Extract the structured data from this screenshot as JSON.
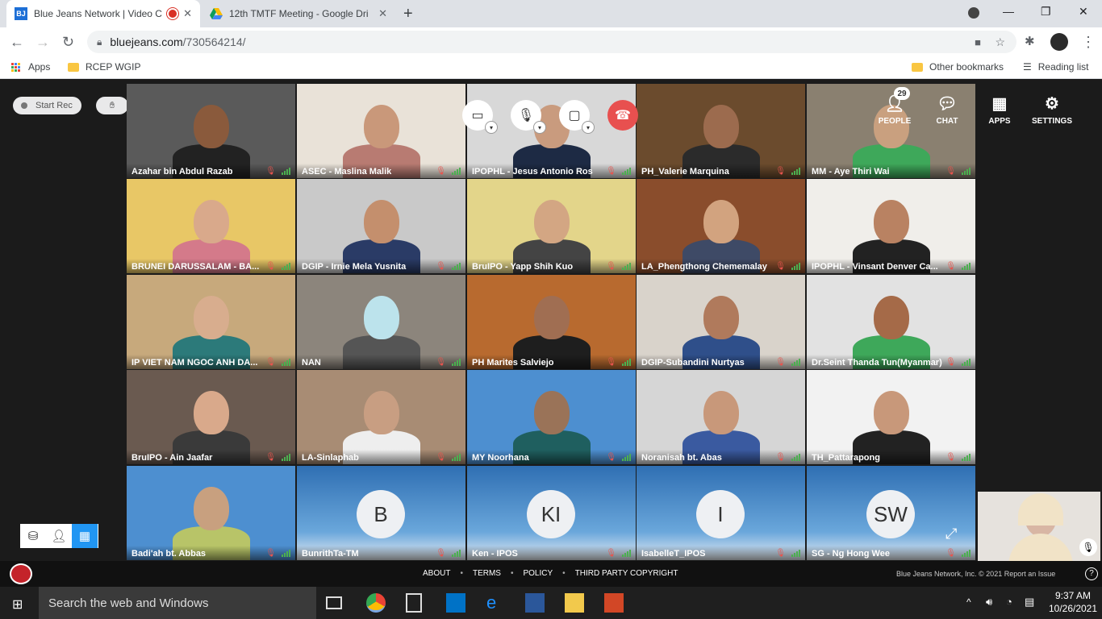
{
  "browser": {
    "tabs": [
      {
        "title": "Blue Jeans Network | Video C",
        "recording": true
      },
      {
        "title": "12th TMTF Meeting - Google Dri"
      }
    ],
    "url_domain": "bluejeans.com",
    "url_path": "/730564214/",
    "bookmarks": {
      "apps": "Apps",
      "folder": "RCEP WGIP",
      "other": "Other bookmarks",
      "reading": "Reading list"
    }
  },
  "meeting": {
    "start_rec": "Start Rec",
    "people_count": "29",
    "right_buttons": {
      "people": "PEOPLE",
      "chat": "CHAT",
      "apps": "APPS",
      "settings": "SETTINGS"
    },
    "participants": [
      {
        "name": "Azahar bin Abdul Razab",
        "bg": "#5a5a5a",
        "skin": "#8a5a3c",
        "cloth": "#222"
      },
      {
        "name": "ASEC - Maslina Malik",
        "bg": "#e9e2d8",
        "skin": "#c9987a",
        "cloth": "#b87b72"
      },
      {
        "name": "IPOPHL - Jesus Antonio Ros",
        "bg": "#d8d8d8",
        "skin": "#c99b7e",
        "cloth": "#1d2a44"
      },
      {
        "name": "PH_Valerie Marquina",
        "bg": "#6b4b2d",
        "skin": "#9c6b4e",
        "cloth": "#2b2b2b"
      },
      {
        "name": "MM - Aye Thiri Wai",
        "bg": "#8a8070",
        "skin": "#c9a07f",
        "cloth": "#3ea85a"
      },
      {
        "name": "BRUNEI DARUSSALAM - BA...",
        "bg": "#e8c766",
        "skin": "#d9a98b",
        "cloth": "#d47a8a"
      },
      {
        "name": "DGIP - Irnie Mela Yusnita",
        "bg": "#c9c9c9",
        "skin": "#c48f6d",
        "cloth": "#2a3b66"
      },
      {
        "name": "BruIPO - Yapp Shih Kuo",
        "bg": "#e3d58a",
        "skin": "#d3a683",
        "cloth": "#444"
      },
      {
        "name": "LA_Phengthong Chememalay",
        "bg": "#8a4d2c",
        "skin": "#d2a37f",
        "cloth": "#3e4a66"
      },
      {
        "name": "IPOPHL - Vinsant Denver Ca...",
        "bg": "#f0eeea",
        "skin": "#b98262",
        "cloth": "#222"
      },
      {
        "name": "IP VIET NAM NGOC ANH DA...",
        "bg": "#c7a97c",
        "skin": "#d8ad8e",
        "cloth": "#2c7a7a"
      },
      {
        "name": "NAN",
        "bg": "#8c857c",
        "skin": "#bce3ec",
        "cloth": "#555"
      },
      {
        "name": "PH Marites Salviejo",
        "bg": "#b86a2f",
        "skin": "#a06e52",
        "cloth": "#1e1e1e"
      },
      {
        "name": "DGIP-Subandini Nurtyas",
        "bg": "#d9d3cb",
        "skin": "#b07a5c",
        "cloth": "#2f4f8a"
      },
      {
        "name": "Dr.Seint Thanda Tun(Myanmar)",
        "bg": "#e2e2e2",
        "skin": "#a56a48",
        "cloth": "#3ea85a"
      },
      {
        "name": "BruIPO - Ain Jaafar",
        "bg": "#6a5a50",
        "skin": "#d9a98b",
        "cloth": "#3a3a3a"
      },
      {
        "name": "LA-Sinlaphab",
        "bg": "#a88c74",
        "skin": "#c89e82",
        "cloth": "#eee"
      },
      {
        "name": "MY Noorhana",
        "bg": "#4d8fd0",
        "skin": "#9a7358",
        "cloth": "#1f5f5f"
      },
      {
        "name": "Noranisah bt. Abas",
        "bg": "#d6d6d6",
        "skin": "#c8987a",
        "cloth": "#3a5aa0"
      },
      {
        "name": "TH_Pattarapong",
        "bg": "#f2f2f2",
        "skin": "#c8987a",
        "cloth": "#222"
      },
      {
        "name": "Badi'ah bt. Abbas",
        "bg": "#4d8fd0",
        "skin": "#c8a07f",
        "cloth": "#b8c468"
      },
      {
        "name": "BunrithTa-TM",
        "avatar": "B"
      },
      {
        "name": "Ken - IPOS",
        "avatar": "KI"
      },
      {
        "name": "IsabelleT_IPOS",
        "avatar": "I"
      },
      {
        "name": "SG - Ng Hong Wee",
        "avatar": "SW"
      }
    ]
  },
  "footer": {
    "links": [
      "ABOUT",
      "TERMS",
      "POLICY",
      "THIRD PARTY COPYRIGHT"
    ],
    "right": "Blue Jeans Network, Inc. © 2021   Report an Issue"
  },
  "taskbar": {
    "search": "Search the web and Windows",
    "time": "9:37 AM",
    "date": "10/26/2021"
  }
}
